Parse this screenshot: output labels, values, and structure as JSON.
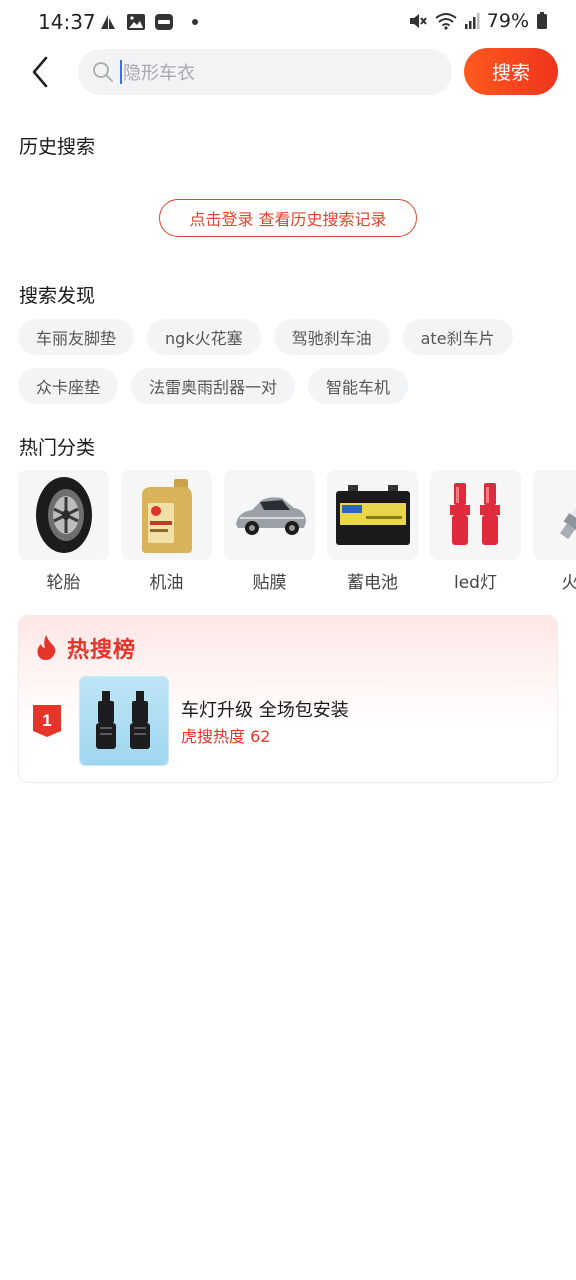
{
  "status": {
    "time": "14:37",
    "battery": "79%"
  },
  "search": {
    "placeholder": "隐形车衣",
    "button": "搜索"
  },
  "history": {
    "title": "历史搜索",
    "login_prompt": "点击登录 查看历史搜索记录"
  },
  "discover": {
    "title": "搜索发现",
    "rows": [
      [
        "车丽友脚垫",
        "ngk火花塞",
        "驾驰刹车油",
        "ate刹车片"
      ],
      [
        "众卡座垫",
        "法雷奥雨刮器一对",
        "智能车机"
      ]
    ]
  },
  "categories": {
    "title": "热门分类",
    "items": [
      {
        "label": "轮胎",
        "icon": "tire-icon"
      },
      {
        "label": "机油",
        "icon": "engine-oil-icon"
      },
      {
        "label": "贴膜",
        "icon": "car-film-icon"
      },
      {
        "label": "蓄电池",
        "icon": "battery-icon"
      },
      {
        "label": "led灯",
        "icon": "led-bulb-icon"
      },
      {
        "label": "火花",
        "icon": "spark-plug-icon"
      }
    ]
  },
  "hot": {
    "title": "热搜榜",
    "items": [
      {
        "rank": "1",
        "title": "车灯升级 全场包安装",
        "heat": "虎搜热度 62"
      }
    ]
  },
  "colors": {
    "accent": "#f0341d",
    "hot_red": "#e5342a"
  }
}
